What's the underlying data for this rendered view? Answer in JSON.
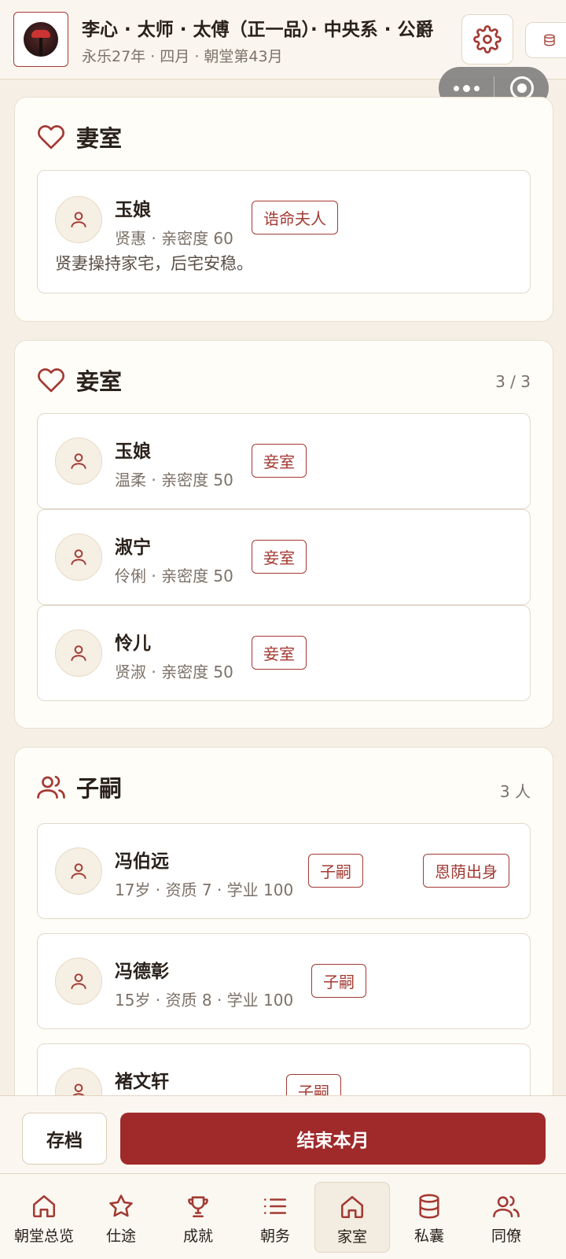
{
  "header": {
    "title": "李心 · 太师 · 太傅（正一品）· 中央系 · 公爵",
    "subtitle": "永乐27年 · 四月 · 朝堂第43月"
  },
  "wife_section": {
    "title": "妻室",
    "card": {
      "name": "玉娘",
      "meta": "贤惠 · 亲密度 60",
      "tag": "诰命夫人",
      "desc": "贤妻操持家宅，后宅安稳。"
    }
  },
  "concubine_section": {
    "title": "妾室",
    "count": "3 / 3",
    "items": [
      {
        "name": "玉娘",
        "meta": "温柔 · 亲密度 50",
        "tag": "妾室"
      },
      {
        "name": "淑宁",
        "meta": "伶俐 · 亲密度 50",
        "tag": "妾室"
      },
      {
        "name": "怜儿",
        "meta": "贤淑 · 亲密度 50",
        "tag": "妾室"
      }
    ]
  },
  "children_section": {
    "title": "子嗣",
    "count": "3 人",
    "items": [
      {
        "name": "冯伯远",
        "meta": "17岁 · 资质 7 · 学业 100",
        "tag": "子嗣",
        "tag2": "恩荫出身"
      },
      {
        "name": "冯德彰",
        "meta": "15岁 · 资质 8 · 学业 100",
        "tag": "子嗣"
      },
      {
        "name": "褚文轩",
        "meta": "",
        "tag": "子嗣"
      }
    ]
  },
  "actions": {
    "save_label": "存档",
    "end_label": "结束本月"
  },
  "nav": {
    "items": [
      {
        "label": "朝堂总览",
        "icon": "home-icon"
      },
      {
        "label": "仕途",
        "icon": "star-icon"
      },
      {
        "label": "成就",
        "icon": "trophy-icon"
      },
      {
        "label": "朝务",
        "icon": "list-icon"
      },
      {
        "label": "家室",
        "icon": "home-icon"
      },
      {
        "label": "私囊",
        "icon": "database-icon"
      },
      {
        "label": "同僚",
        "icon": "users-icon"
      }
    ],
    "active_index": 4
  },
  "colors": {
    "accent": "#a0292a",
    "tag_border": "#a33a33",
    "background": "#f5efe5"
  }
}
